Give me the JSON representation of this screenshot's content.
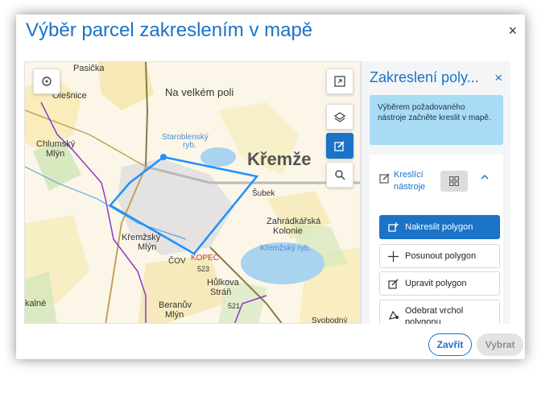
{
  "dialog": {
    "title": "Výběr parcel zakreslením v mapě",
    "close_glyph": "×"
  },
  "map": {
    "labels": {
      "pasicka": "Pasička",
      "olesnice": "Olešnice",
      "na_velkem_poli": "Na velkém poli",
      "staroblensky": "Staroblenský",
      "ryb": "ryb.",
      "kremze": "Křemže",
      "chlumsky": "Chlumský",
      "mlyn": "Mlýn",
      "kremzsky": "Křemžský",
      "mlyn2": "Mlýn",
      "kremzsky_ryb": "Křemžský ryb.",
      "zahradkarska": "Zahrádkářská",
      "kolonie": "Kolonie",
      "subek": "Šubek",
      "kopec": "KOPEC",
      "cov": "ČOV",
      "n523": "523",
      "hulkova": "Hůlkova",
      "stran": "Stráň",
      "n521": "521",
      "beranuv": "Beranův",
      "mlyn3": "Mlýn",
      "kalne": "kalné",
      "svobodny": "Svobodný"
    },
    "polygon_points": "Drawn polygon with vertices"
  },
  "panel": {
    "title": "Zakreslení poly...",
    "close_glyph": "×",
    "info": "Výběrem požadovaného nástroje začněte kreslit v mapě.",
    "tools_label_line1": "Kreslící",
    "tools_label_line2": "nástroje",
    "chevron": "^",
    "tools": [
      {
        "label": "Nakreslit polygon",
        "icon": "polygon-add-icon"
      },
      {
        "label": "Posunout polygon",
        "icon": "move-icon"
      },
      {
        "label": "Upravit polygon",
        "icon": "edit-icon"
      },
      {
        "label": "Odebrat vrchol",
        "label2": "polygonu",
        "icon": "remove-vertex-icon"
      }
    ]
  },
  "footer": {
    "close_label": "Zavřít",
    "select_label": "Vybrat"
  },
  "colors": {
    "accent": "#1a73c7",
    "info_bg": "#a8dcf5",
    "polygon": "#1e90ff"
  }
}
